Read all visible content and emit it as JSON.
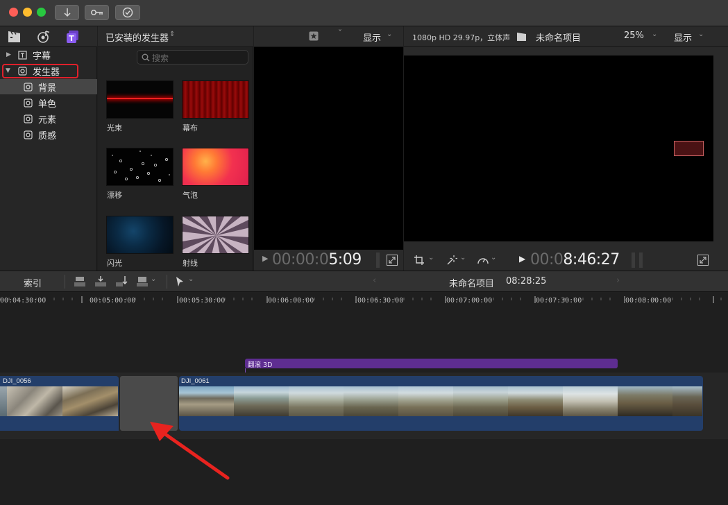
{
  "titlebar": {
    "buttons": [
      "download-icon",
      "key-icon",
      "check-circle-icon"
    ]
  },
  "browser": {
    "library_icons": [
      "clapper-icon",
      "music-photo-icon",
      "titles-generators-icon"
    ],
    "category_label": "已安装的发生器",
    "search_placeholder": "搜索",
    "sidebar": [
      {
        "label": "字幕",
        "expanded": false
      },
      {
        "label": "发生器",
        "expanded": true,
        "highlighted": true
      },
      {
        "label": "背景",
        "selected": true
      },
      {
        "label": "单色"
      },
      {
        "label": "元素"
      },
      {
        "label": "质感"
      }
    ],
    "thumbnails": [
      {
        "label": "光束"
      },
      {
        "label": "幕布"
      },
      {
        "label": "漂移"
      },
      {
        "label": "气泡"
      },
      {
        "label": "闪光"
      },
      {
        "label": "射线"
      }
    ]
  },
  "event_viewer": {
    "display_label": "显示",
    "timecode_dim": "00:00:0",
    "timecode_bright": "5:09"
  },
  "project_viewer": {
    "format": "1080p HD 29.97p，立体声",
    "project_name": "未命名项目",
    "zoom": "25%",
    "display_label": "显示",
    "timecode_dim": "00:0",
    "timecode_bright": "8:46:27"
  },
  "timeline": {
    "index_label": "索引",
    "project_name": "未命名项目",
    "duration": "08:28:25",
    "ruler": [
      "00:04:30:00",
      "00:05:00:00",
      "00:05:30:00",
      "00:06:00:00",
      "00:06:30:00",
      "00:07:00:00",
      "00:07:30:00",
      "00:08:00:00"
    ],
    "transition_label": "翻滚 3D",
    "clips": [
      {
        "name": "DJI_0056"
      },
      {
        "name": "DJI_0061"
      }
    ]
  },
  "colors": {
    "accent_purple": "#5e2d91",
    "clip_blue": "#233e6a",
    "highlight_red": "#e0202b",
    "arrow_red": "#e8231f"
  }
}
